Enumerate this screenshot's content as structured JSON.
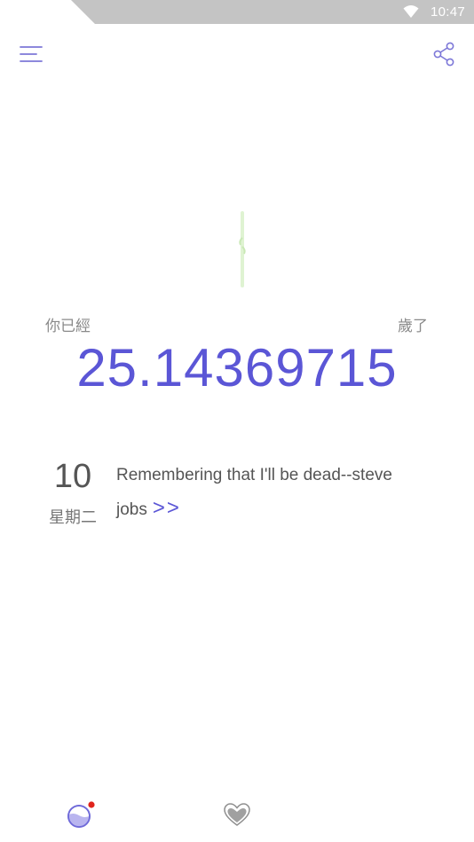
{
  "status_bar": {
    "time": "10:47",
    "wifi_icon": "wifi-icon",
    "color": "#c4c4c4"
  },
  "app_bar": {
    "menu_icon": "menu-icon",
    "share_icon": "share-icon"
  },
  "age": {
    "prefix": "你已經",
    "value": "25.14369715",
    "suffix": "歲了",
    "color": "#5b56d6"
  },
  "daily": {
    "day": "10",
    "weekday": "星期二",
    "quote": "Remembering that I'll be dead--steve jobs",
    "more": ">>"
  },
  "bottom_nav": {
    "items": [
      {
        "icon": "life-globe-icon",
        "badge": true
      },
      {
        "icon": "heart-icon",
        "badge": false
      }
    ]
  },
  "colors": {
    "accent": "#5b56d6",
    "badge": "#e0241c",
    "sprout": "#d9f2c9"
  }
}
